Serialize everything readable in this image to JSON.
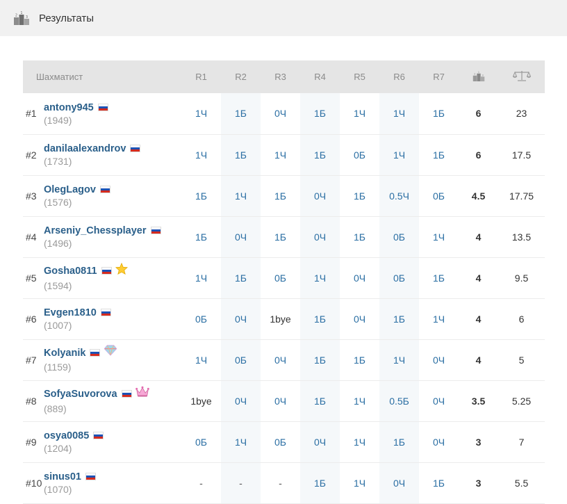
{
  "header": {
    "title": "Результаты",
    "icon": "podium-icon"
  },
  "table": {
    "columns": {
      "player": "Шахматист",
      "rounds": [
        "R1",
        "R2",
        "R3",
        "R4",
        "R5",
        "R6",
        "R7"
      ],
      "points_icon": "podium-icon",
      "tiebreak_icon": "scales-icon"
    },
    "rows": [
      {
        "rank": "#1",
        "name": "antony945",
        "rating": "(1949)",
        "badge": "",
        "results": [
          "1Ч",
          "1Б",
          "0Ч",
          "1Б",
          "1Ч",
          "1Ч",
          "1Б"
        ],
        "points": "6",
        "tiebreak": "23"
      },
      {
        "rank": "#2",
        "name": "danilaalexandrov",
        "rating": "(1731)",
        "badge": "",
        "results": [
          "1Ч",
          "1Б",
          "1Ч",
          "1Б",
          "0Б",
          "1Ч",
          "1Б"
        ],
        "points": "6",
        "tiebreak": "17.5"
      },
      {
        "rank": "#3",
        "name": "OlegLagov",
        "rating": "(1576)",
        "badge": "",
        "results": [
          "1Б",
          "1Ч",
          "1Б",
          "0Ч",
          "1Б",
          "0.5Ч",
          "0Б"
        ],
        "points": "4.5",
        "tiebreak": "17.75"
      },
      {
        "rank": "#4",
        "name": "Arseniy_Chessplayer",
        "rating": "(1496)",
        "badge": "",
        "results": [
          "1Б",
          "0Ч",
          "1Б",
          "0Ч",
          "1Б",
          "0Б",
          "1Ч"
        ],
        "points": "4",
        "tiebreak": "13.5"
      },
      {
        "rank": "#5",
        "name": "Gosha0811",
        "rating": "(1594)",
        "badge": "star-icon",
        "results": [
          "1Ч",
          "1Б",
          "0Б",
          "1Ч",
          "0Ч",
          "0Б",
          "1Б"
        ],
        "points": "4",
        "tiebreak": "9.5"
      },
      {
        "rank": "#6",
        "name": "Evgen1810",
        "rating": "(1007)",
        "badge": "",
        "results": [
          "0Б",
          "0Ч",
          "1bye",
          "1Б",
          "0Ч",
          "1Б",
          "1Ч"
        ],
        "points": "4",
        "tiebreak": "6"
      },
      {
        "rank": "#7",
        "name": "Kolyanik",
        "rating": "(1159)",
        "badge": "diamond-icon",
        "results": [
          "1Ч",
          "0Б",
          "0Ч",
          "1Б",
          "1Б",
          "1Ч",
          "0Ч"
        ],
        "points": "4",
        "tiebreak": "5"
      },
      {
        "rank": "#8",
        "name": "SofyaSuvorova",
        "rating": "(889)",
        "badge": "crown-icon",
        "results": [
          "1bye",
          "0Ч",
          "0Ч",
          "1Б",
          "1Ч",
          "0.5Б",
          "0Ч"
        ],
        "points": "3.5",
        "tiebreak": "5.25"
      },
      {
        "rank": "#9",
        "name": "osya0085",
        "rating": "(1204)",
        "badge": "",
        "results": [
          "0Б",
          "1Ч",
          "0Б",
          "0Ч",
          "1Ч",
          "1Б",
          "0Ч"
        ],
        "points": "3",
        "tiebreak": "7"
      },
      {
        "rank": "#10",
        "name": "sinus01",
        "rating": "(1070)",
        "badge": "",
        "results": [
          "-",
          "-",
          "-",
          "1Б",
          "1Ч",
          "0Ч",
          "1Б"
        ],
        "points": "3",
        "tiebreak": "5.5"
      }
    ]
  },
  "colors": {
    "link": "#2a5f8a",
    "round_link": "#2a6ea3",
    "header_bg": "#f1f1f1",
    "thead_bg": "#e5e5e5"
  },
  "flag_icon": "russia-flag-icon"
}
